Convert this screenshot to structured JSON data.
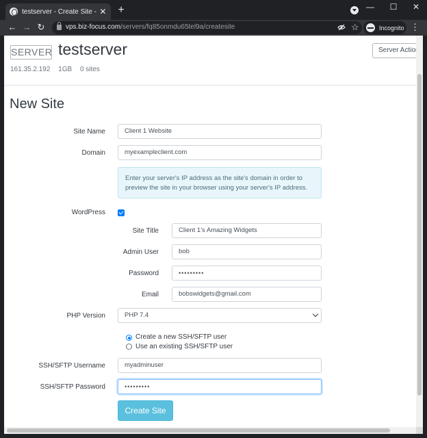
{
  "browser": {
    "tab_title": "testserver - Create Site - Biz-Focus",
    "tab_close": "✕",
    "new_tab": "+",
    "url_host": "vps.biz-focus.com",
    "url_path": "/servers/fq85onmdu65tel9a/createsite",
    "incognito_label": "Incognito",
    "icons": [
      "globe-icon",
      "back-icon",
      "forward-icon",
      "reload-icon",
      "lock-icon",
      "eye-off-icon",
      "star-icon",
      "incognito-icon",
      "menu-icon",
      "minimize-icon",
      "maximize-icon",
      "close-icon"
    ]
  },
  "server": {
    "badge": "SERVER",
    "name": "testserver",
    "actions_label": "Server Actions",
    "ip": "161.35.2.192",
    "memory": "1GB",
    "sites": "0 sites"
  },
  "form": {
    "heading": "New Site",
    "site_name": {
      "label": "Site Name",
      "value": "Client 1 Website"
    },
    "domain": {
      "label": "Domain",
      "value": "myexampleclient.com"
    },
    "domain_help": "Enter your server's IP address as the site's domain in order to preview the site in your browser using your server's IP address.",
    "wordpress": {
      "label": "WordPress",
      "checked": true
    },
    "site_title": {
      "label": "Site Title",
      "value": "Client 1's Amazing Widgets"
    },
    "admin_user": {
      "label": "Admin User",
      "value": "bob"
    },
    "password": {
      "label": "Password",
      "value": "•••••••••"
    },
    "email": {
      "label": "Email",
      "value": "bobswidgets@gmail.com"
    },
    "php_version": {
      "label": "PHP Version",
      "value": "PHP 7.4"
    },
    "ssh_options": [
      {
        "label": "Create a new SSH/SFTP user",
        "checked": true
      },
      {
        "label": "Use an existing SSH/SFTP user",
        "checked": false
      }
    ],
    "ssh_username": {
      "label": "SSH/SFTP Username",
      "value": "myadminuser"
    },
    "ssh_password": {
      "label": "SSH/SFTP Password",
      "value": "•••••••••"
    },
    "submit_label": "Create Site"
  },
  "colors": {
    "accent": "#007bff",
    "button": "#5bc0de",
    "alert_bg": "#e8f6fb"
  }
}
